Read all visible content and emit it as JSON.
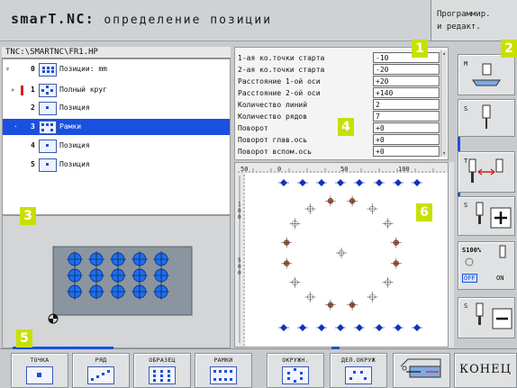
{
  "title_main": "smarT.NC:",
  "title_sub": "определение позиции",
  "mode_lines": [
    "Программир.",
    "и редакт."
  ],
  "path": "TNC:\\SMARTNC\\FR1.HP",
  "tree": [
    {
      "num": "0",
      "label": "Позиции: mm",
      "expander": "▿"
    },
    {
      "num": "1",
      "label": "Полный круг",
      "expander": "▹"
    },
    {
      "num": "2",
      "label": "Позиция",
      "expander": ""
    },
    {
      "num": "3",
      "label": "Рамки",
      "expander": "·"
    },
    {
      "num": "4",
      "label": "Позиция",
      "expander": ""
    },
    {
      "num": "5",
      "label": "Позиция",
      "expander": ""
    }
  ],
  "form": [
    {
      "label": "1-ая ко.точки старта",
      "value": "-10"
    },
    {
      "label": "2-ая ко.точки старта",
      "value": "-20"
    },
    {
      "label": "Расстояние 1-ой оси",
      "value": "+20"
    },
    {
      "label": "Расстояние 2-ой оси",
      "value": "+140"
    },
    {
      "label": "Количество линий",
      "value": "2"
    },
    {
      "label": "Количество рядов",
      "value": "7"
    },
    {
      "label": "Поворот",
      "value": "+0"
    },
    {
      "label": "Поворот глав.ось",
      "value": "+0"
    },
    {
      "label": "Поворот вспом.ось",
      "value": "+0"
    }
  ],
  "ruler_ticks": [
    "50",
    "0",
    "50",
    "100"
  ],
  "left_ruler": [
    "1",
    "0",
    "0",
    "5",
    "0",
    "0"
  ],
  "right_keys": {
    "m": "M",
    "s1": "S",
    "t": "T",
    "s2": "S",
    "s100": "S100%",
    "off": "OFF",
    "on": "ON",
    "s3": "S"
  },
  "bottom_keys": [
    "ТОЧКА",
    "РЯД",
    "ОБРАЗЕЦ",
    "РАМКИ",
    "ОКРУЖН.",
    "ДЕЛ.ОКРУЖ",
    "",
    "КОНЕЦ"
  ],
  "badges": [
    "1",
    "2",
    "3",
    "4",
    "5",
    "6"
  ],
  "colors": {
    "accent_blue": "#1a50e0",
    "badge_green": "#c8e000",
    "hole_blue": "#1b6ff0"
  }
}
